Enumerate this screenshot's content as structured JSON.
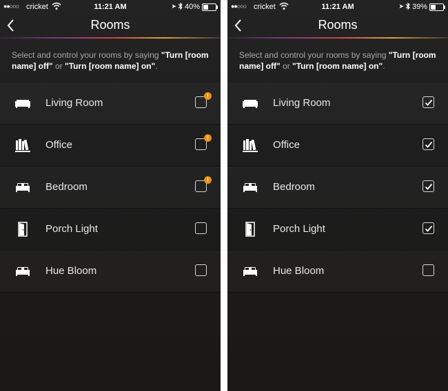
{
  "screens": [
    {
      "status": {
        "carrier": "cricket",
        "time": "11:21 AM",
        "battery": "40%",
        "battery_level": 0.4
      },
      "nav": {
        "title": "Rooms"
      },
      "instructions": {
        "prefix": "Select and control your rooms by saying ",
        "cmd_off": "\"Turn [room name] off\"",
        "mid": " or ",
        "cmd_on": "\"Turn [room name] on\"",
        "suffix": "."
      },
      "rooms": [
        {
          "label": "Living Room",
          "icon": "sofa-icon",
          "checked": false,
          "alert": true
        },
        {
          "label": "Office",
          "icon": "bookshelf-icon",
          "checked": false,
          "alert": true
        },
        {
          "label": "Bedroom",
          "icon": "bed-icon",
          "checked": false,
          "alert": true
        },
        {
          "label": "Porch Light",
          "icon": "door-icon",
          "checked": false,
          "alert": false
        },
        {
          "label": "Hue Bloom",
          "icon": "bed-icon",
          "checked": false,
          "alert": false
        }
      ]
    },
    {
      "status": {
        "carrier": "cricket",
        "time": "11:21 AM",
        "battery": "39%",
        "battery_level": 0.39
      },
      "nav": {
        "title": "Rooms"
      },
      "instructions": {
        "prefix": "Select and control your rooms by saying ",
        "cmd_off": "\"Turn [room name] off\"",
        "mid": " or ",
        "cmd_on": "\"Turn [room name] on\"",
        "suffix": "."
      },
      "rooms": [
        {
          "label": "Living Room",
          "icon": "sofa-icon",
          "checked": true,
          "alert": false
        },
        {
          "label": "Office",
          "icon": "bookshelf-icon",
          "checked": true,
          "alert": false
        },
        {
          "label": "Bedroom",
          "icon": "bed-icon",
          "checked": true,
          "alert": false
        },
        {
          "label": "Porch Light",
          "icon": "door-icon",
          "checked": true,
          "alert": false
        },
        {
          "label": "Hue Bloom",
          "icon": "bed-icon",
          "checked": false,
          "alert": false
        }
      ]
    }
  ],
  "alert_symbol": "!",
  "colors": {
    "alert": "#e8901a",
    "background": "#1e1e1e",
    "text": "#e8e8e8",
    "muted": "#a8a8a8"
  }
}
